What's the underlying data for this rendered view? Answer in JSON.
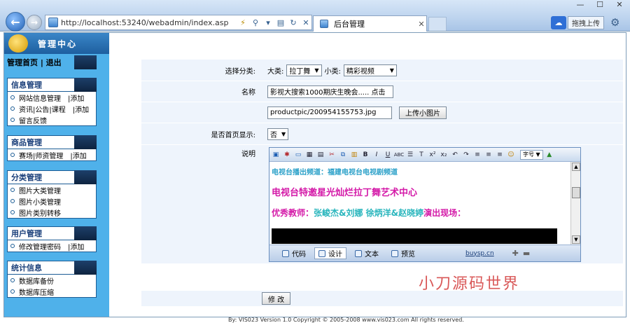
{
  "browser": {
    "url": "http://localhost:53240/webadmin/index.asp",
    "tab_title": "后台管理",
    "upload_label": "拖拽上传"
  },
  "sidebar": {
    "title": "管理中心",
    "home_links": "管理首页 | 退出",
    "sections": [
      {
        "title": "信息管理",
        "items": [
          "网站信息管理　|添加",
          "资讯|公告|课程　|添加",
          "留言反馈"
        ]
      },
      {
        "title": "商品管理",
        "items": [
          "赛场|师资管理　|添加"
        ]
      },
      {
        "title": "分类管理",
        "items": [
          "图片大类管理",
          "图片小类管理",
          "图片类别转移"
        ]
      },
      {
        "title": "用户管理",
        "items": [
          "修改管理密码　|添加"
        ]
      },
      {
        "title": "统计信息",
        "items": [
          "数据库备份",
          "数据库压缩"
        ]
      }
    ]
  },
  "form": {
    "category_label": "选择分类:",
    "big_cat_label": "大类:",
    "big_cat_value": "拉丁舞",
    "small_cat_label": "小类:",
    "small_cat_value": "精彩视频",
    "name_label": "名称",
    "name_value": "影视大搜索1000期庆生晚会..... 点击",
    "image_path": "productpic/200954155753.jpg",
    "upload_button": "上传小图片",
    "homepage_label": "是否首页显示:",
    "homepage_value": "否",
    "desc_label": "说明",
    "submit_button": "修 改"
  },
  "editor": {
    "font_size_select": "字号",
    "line1": "电视台播出频道：福建电视台电视剧频道",
    "line2": "电视台特邀星光灿烂拉丁舞艺术中心",
    "line3_a": "优秀教师：",
    "line3_b": "张峻杰&刘娜 徐炳洋&赵晓婷",
    "line3_c": "演出现场：",
    "tabs": [
      "代码",
      "设计",
      "文本",
      "预览"
    ],
    "powered": "buysp.cn"
  },
  "footer": "By: VIS023 Version 1.0 Copyright © 2005-2008 www.vis023.com All rights reserved.",
  "watermark": "小刀源码世界"
}
